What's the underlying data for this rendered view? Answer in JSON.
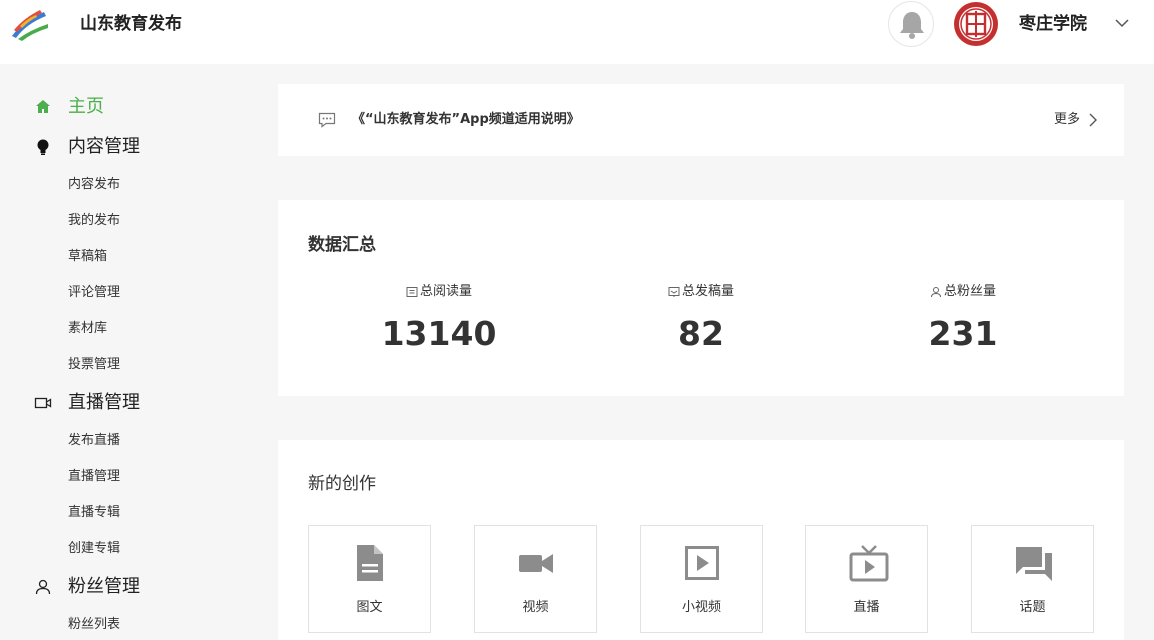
{
  "header": {
    "brand": "山东教育发布",
    "school": "枣庄学院"
  },
  "sidebar": {
    "home": "主页",
    "content": {
      "label": "内容管理",
      "items": [
        "内容发布",
        "我的发布",
        "草稿箱",
        "评论管理",
        "素材库",
        "投票管理"
      ]
    },
    "live": {
      "label": "直播管理",
      "items": [
        "发布直播",
        "直播管理",
        "直播专辑",
        "创建专辑"
      ]
    },
    "fans": {
      "label": "粉丝管理",
      "items": [
        "粉丝列表"
      ]
    }
  },
  "notice": {
    "title": "《“山东教育发布”App频道适用说明》",
    "more": "更多"
  },
  "stats": {
    "title": "数据汇总",
    "items": [
      {
        "label": "总阅读量",
        "value": "13140"
      },
      {
        "label": "总发稿量",
        "value": "82"
      },
      {
        "label": "总粉丝量",
        "value": "231"
      }
    ]
  },
  "create": {
    "title": "新的创作",
    "tiles": [
      {
        "label": "图文",
        "icon": "document-icon"
      },
      {
        "label": "视频",
        "icon": "video-camera-icon"
      },
      {
        "label": "小视频",
        "icon": "play-square-icon"
      },
      {
        "label": "直播",
        "icon": "tv-icon"
      },
      {
        "label": "话题",
        "icon": "chat-icon"
      }
    ]
  },
  "colors": {
    "accent": "#4cae4c",
    "icon_gray": "#8c8c8c"
  }
}
